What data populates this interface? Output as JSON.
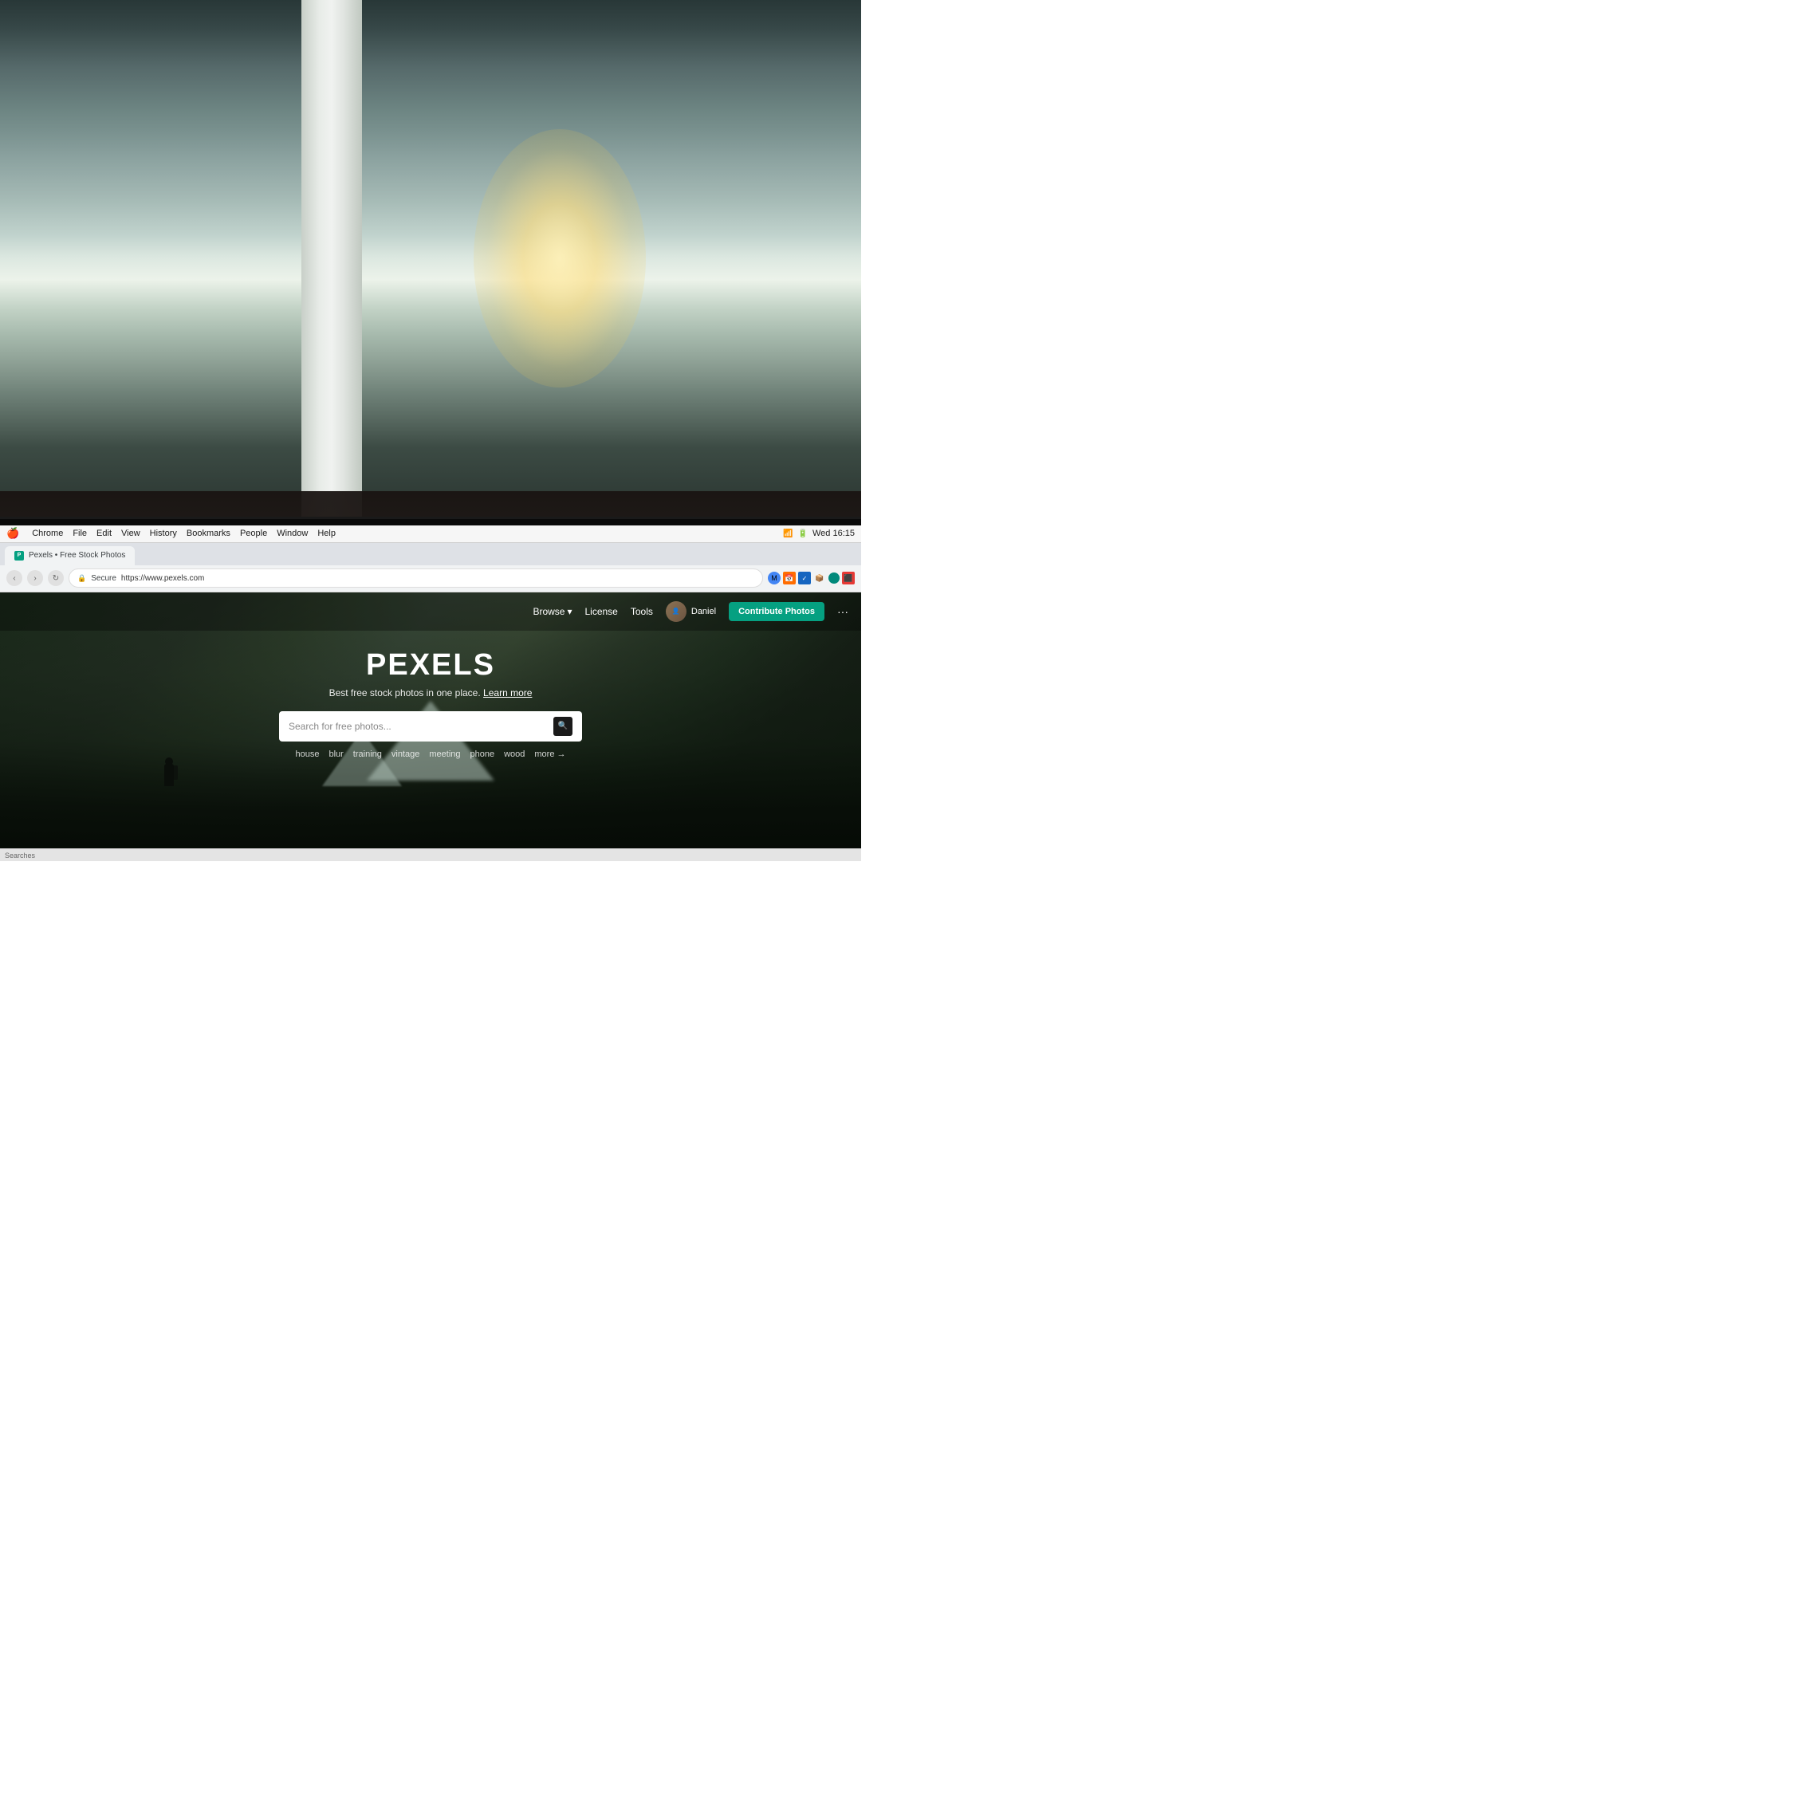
{
  "background": {
    "alt": "Office background with blurred workspaces and natural light"
  },
  "menubar": {
    "apple": "🍎",
    "app_name": "Chrome",
    "menus": [
      "File",
      "Edit",
      "View",
      "History",
      "Bookmarks",
      "People",
      "Window",
      "Help"
    ],
    "time": "Wed 16:15",
    "battery": "100%"
  },
  "browser": {
    "tab": {
      "label": "Pexels • Free Stock Photos"
    },
    "address": {
      "secure_label": "Secure",
      "url": "https://www.pexels.com"
    }
  },
  "pexels": {
    "nav": {
      "browse": "Browse",
      "license": "License",
      "tools": "Tools",
      "user": "Daniel",
      "contribute": "Contribute Photos",
      "more_icon": "···"
    },
    "hero": {
      "logo": "PEXELS",
      "tagline": "Best free stock photos in one place.",
      "learn_more": "Learn more",
      "search_placeholder": "Search for free photos...",
      "tags": [
        "house",
        "blur",
        "training",
        "vintage",
        "meeting",
        "phone",
        "wood"
      ],
      "more_label": "more →"
    }
  },
  "status_bar": {
    "text": "Searches"
  }
}
